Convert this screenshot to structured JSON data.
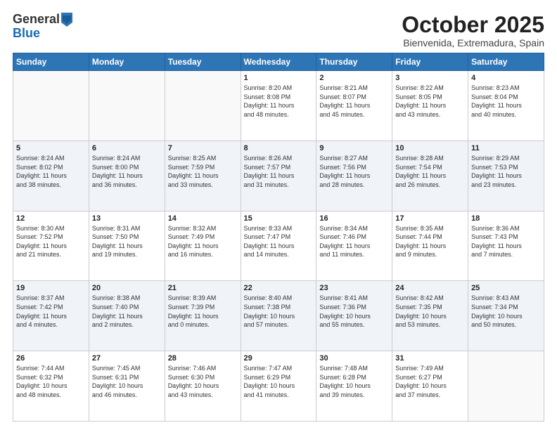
{
  "header": {
    "logo_line1": "General",
    "logo_line2": "Blue",
    "month": "October 2025",
    "location": "Bienvenida, Extremadura, Spain"
  },
  "days_of_week": [
    "Sunday",
    "Monday",
    "Tuesday",
    "Wednesday",
    "Thursday",
    "Friday",
    "Saturday"
  ],
  "weeks": [
    [
      {
        "day": "",
        "info": ""
      },
      {
        "day": "",
        "info": ""
      },
      {
        "day": "",
        "info": ""
      },
      {
        "day": "1",
        "info": "Sunrise: 8:20 AM\nSunset: 8:08 PM\nDaylight: 11 hours\nand 48 minutes."
      },
      {
        "day": "2",
        "info": "Sunrise: 8:21 AM\nSunset: 8:07 PM\nDaylight: 11 hours\nand 45 minutes."
      },
      {
        "day": "3",
        "info": "Sunrise: 8:22 AM\nSunset: 8:05 PM\nDaylight: 11 hours\nand 43 minutes."
      },
      {
        "day": "4",
        "info": "Sunrise: 8:23 AM\nSunset: 8:04 PM\nDaylight: 11 hours\nand 40 minutes."
      }
    ],
    [
      {
        "day": "5",
        "info": "Sunrise: 8:24 AM\nSunset: 8:02 PM\nDaylight: 11 hours\nand 38 minutes."
      },
      {
        "day": "6",
        "info": "Sunrise: 8:24 AM\nSunset: 8:00 PM\nDaylight: 11 hours\nand 36 minutes."
      },
      {
        "day": "7",
        "info": "Sunrise: 8:25 AM\nSunset: 7:59 PM\nDaylight: 11 hours\nand 33 minutes."
      },
      {
        "day": "8",
        "info": "Sunrise: 8:26 AM\nSunset: 7:57 PM\nDaylight: 11 hours\nand 31 minutes."
      },
      {
        "day": "9",
        "info": "Sunrise: 8:27 AM\nSunset: 7:56 PM\nDaylight: 11 hours\nand 28 minutes."
      },
      {
        "day": "10",
        "info": "Sunrise: 8:28 AM\nSunset: 7:54 PM\nDaylight: 11 hours\nand 26 minutes."
      },
      {
        "day": "11",
        "info": "Sunrise: 8:29 AM\nSunset: 7:53 PM\nDaylight: 11 hours\nand 23 minutes."
      }
    ],
    [
      {
        "day": "12",
        "info": "Sunrise: 8:30 AM\nSunset: 7:52 PM\nDaylight: 11 hours\nand 21 minutes."
      },
      {
        "day": "13",
        "info": "Sunrise: 8:31 AM\nSunset: 7:50 PM\nDaylight: 11 hours\nand 19 minutes."
      },
      {
        "day": "14",
        "info": "Sunrise: 8:32 AM\nSunset: 7:49 PM\nDaylight: 11 hours\nand 16 minutes."
      },
      {
        "day": "15",
        "info": "Sunrise: 8:33 AM\nSunset: 7:47 PM\nDaylight: 11 hours\nand 14 minutes."
      },
      {
        "day": "16",
        "info": "Sunrise: 8:34 AM\nSunset: 7:46 PM\nDaylight: 11 hours\nand 11 minutes."
      },
      {
        "day": "17",
        "info": "Sunrise: 8:35 AM\nSunset: 7:44 PM\nDaylight: 11 hours\nand 9 minutes."
      },
      {
        "day": "18",
        "info": "Sunrise: 8:36 AM\nSunset: 7:43 PM\nDaylight: 11 hours\nand 7 minutes."
      }
    ],
    [
      {
        "day": "19",
        "info": "Sunrise: 8:37 AM\nSunset: 7:42 PM\nDaylight: 11 hours\nand 4 minutes."
      },
      {
        "day": "20",
        "info": "Sunrise: 8:38 AM\nSunset: 7:40 PM\nDaylight: 11 hours\nand 2 minutes."
      },
      {
        "day": "21",
        "info": "Sunrise: 8:39 AM\nSunset: 7:39 PM\nDaylight: 11 hours\nand 0 minutes."
      },
      {
        "day": "22",
        "info": "Sunrise: 8:40 AM\nSunset: 7:38 PM\nDaylight: 10 hours\nand 57 minutes."
      },
      {
        "day": "23",
        "info": "Sunrise: 8:41 AM\nSunset: 7:36 PM\nDaylight: 10 hours\nand 55 minutes."
      },
      {
        "day": "24",
        "info": "Sunrise: 8:42 AM\nSunset: 7:35 PM\nDaylight: 10 hours\nand 53 minutes."
      },
      {
        "day": "25",
        "info": "Sunrise: 8:43 AM\nSunset: 7:34 PM\nDaylight: 10 hours\nand 50 minutes."
      }
    ],
    [
      {
        "day": "26",
        "info": "Sunrise: 7:44 AM\nSunset: 6:32 PM\nDaylight: 10 hours\nand 48 minutes."
      },
      {
        "day": "27",
        "info": "Sunrise: 7:45 AM\nSunset: 6:31 PM\nDaylight: 10 hours\nand 46 minutes."
      },
      {
        "day": "28",
        "info": "Sunrise: 7:46 AM\nSunset: 6:30 PM\nDaylight: 10 hours\nand 43 minutes."
      },
      {
        "day": "29",
        "info": "Sunrise: 7:47 AM\nSunset: 6:29 PM\nDaylight: 10 hours\nand 41 minutes."
      },
      {
        "day": "30",
        "info": "Sunrise: 7:48 AM\nSunset: 6:28 PM\nDaylight: 10 hours\nand 39 minutes."
      },
      {
        "day": "31",
        "info": "Sunrise: 7:49 AM\nSunset: 6:27 PM\nDaylight: 10 hours\nand 37 minutes."
      },
      {
        "day": "",
        "info": ""
      }
    ]
  ]
}
